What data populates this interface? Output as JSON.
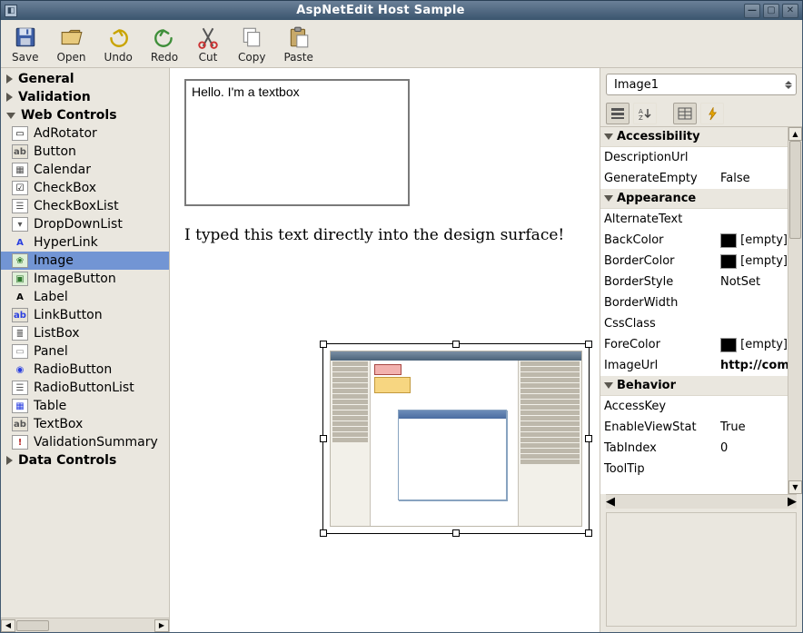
{
  "window": {
    "title": "AspNetEdit Host Sample"
  },
  "toolbar": [
    {
      "name": "save-button",
      "label": "Save",
      "icon": "save-icon"
    },
    {
      "name": "open-button",
      "label": "Open",
      "icon": "open-icon"
    },
    {
      "name": "undo-button",
      "label": "Undo",
      "icon": "undo-icon"
    },
    {
      "name": "redo-button",
      "label": "Redo",
      "icon": "redo-icon"
    },
    {
      "name": "cut-button",
      "label": "Cut",
      "icon": "cut-icon"
    },
    {
      "name": "copy-button",
      "label": "Copy",
      "icon": "copy-icon"
    },
    {
      "name": "paste-button",
      "label": "Paste",
      "icon": "paste-icon"
    }
  ],
  "toolbox": {
    "categories": [
      {
        "name": "General",
        "expanded": false
      },
      {
        "name": "Validation",
        "expanded": false
      },
      {
        "name": "Web Controls",
        "expanded": true,
        "items": [
          {
            "name": "AdRotator",
            "icon": "adrotator-icon"
          },
          {
            "name": "Button",
            "icon": "button-icon"
          },
          {
            "name": "Calendar",
            "icon": "calendar-icon"
          },
          {
            "name": "CheckBox",
            "icon": "checkbox-icon"
          },
          {
            "name": "CheckBoxList",
            "icon": "checkboxlist-icon"
          },
          {
            "name": "DropDownList",
            "icon": "dropdown-icon"
          },
          {
            "name": "HyperLink",
            "icon": "hyperlink-icon"
          },
          {
            "name": "Image",
            "icon": "image-icon",
            "selected": true
          },
          {
            "name": "ImageButton",
            "icon": "imagebutton-icon"
          },
          {
            "name": "Label",
            "icon": "label-icon"
          },
          {
            "name": "LinkButton",
            "icon": "linkbutton-icon"
          },
          {
            "name": "ListBox",
            "icon": "listbox-icon"
          },
          {
            "name": "Panel",
            "icon": "panel-icon"
          },
          {
            "name": "RadioButton",
            "icon": "radio-icon"
          },
          {
            "name": "RadioButtonList",
            "icon": "radiolist-icon"
          },
          {
            "name": "Table",
            "icon": "table-icon"
          },
          {
            "name": "TextBox",
            "icon": "textbox-icon"
          },
          {
            "name": "ValidationSummary",
            "icon": "valsum-icon"
          }
        ]
      },
      {
        "name": "Data Controls",
        "expanded": false
      }
    ]
  },
  "design": {
    "textbox_value": "Hello. I'm a textbox",
    "free_text": "I typed this text directly into the design surface!"
  },
  "propgrid": {
    "selected_object": "Image1",
    "categories": [
      {
        "name": "Accessibility",
        "props": [
          {
            "name": "DescriptionUrl",
            "value": ""
          },
          {
            "name": "GenerateEmptyAlternateText",
            "display_name": "GenerateEmpty",
            "value": "False"
          }
        ]
      },
      {
        "name": "Appearance",
        "props": [
          {
            "name": "AlternateText",
            "value": ""
          },
          {
            "name": "BackColor",
            "value": "[empty]",
            "swatch": "#000000"
          },
          {
            "name": "BorderColor",
            "value": "[empty]",
            "swatch": "#000000"
          },
          {
            "name": "BorderStyle",
            "value": "NotSet"
          },
          {
            "name": "BorderWidth",
            "value": ""
          },
          {
            "name": "CssClass",
            "value": ""
          },
          {
            "name": "ForeColor",
            "value": "[empty]",
            "swatch": "#000000"
          },
          {
            "name": "ImageUrl",
            "value": "http://com",
            "bold": true
          }
        ]
      },
      {
        "name": "Behavior",
        "props": [
          {
            "name": "AccessKey",
            "value": ""
          },
          {
            "name": "EnableViewState",
            "display_name": "EnableViewStat",
            "value": "True"
          },
          {
            "name": "TabIndex",
            "value": "0"
          },
          {
            "name": "ToolTip",
            "value": ""
          }
        ]
      }
    ]
  }
}
